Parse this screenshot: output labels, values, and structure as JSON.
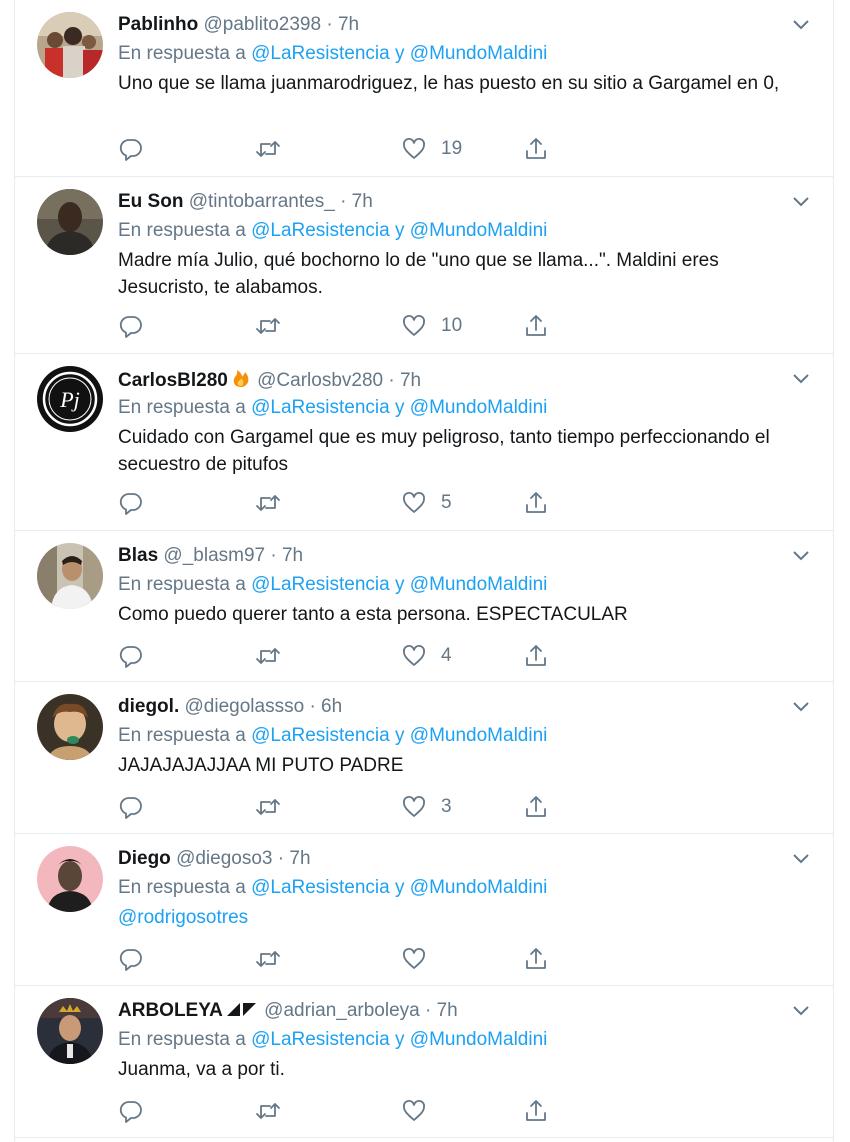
{
  "tweets": [
    {
      "name": "Pablinho",
      "handle": "@pablito2398",
      "time": "7h",
      "reply_prefix": "En respuesta a",
      "reply_to_1": "@LaResistencia",
      "reply_and": "y",
      "reply_to_2": "@MundoMaldini",
      "text": "Uno que se llama juanmarodriguez, le has puesto en su sitio a Gargamel en 0,",
      "likes": "19",
      "avatar": "avatar-group-red-shirts"
    },
    {
      "name": "Eu Son",
      "handle": "@tintobarrantes_",
      "time": "7h",
      "reply_prefix": "En respuesta a",
      "reply_to_1": "@LaResistencia",
      "reply_and": "y",
      "reply_to_2": "@MundoMaldini",
      "text": "Madre mía Julio, qué bochorno lo de \"uno que se llama...\". Maldini eres Jesucristo, te alabamos.",
      "likes": "10",
      "avatar": "avatar-man-dark"
    },
    {
      "name": "CarlosBl280",
      "name_badge": "fire-emoji",
      "handle": "@Carlosbv280",
      "time": "7h",
      "reply_prefix": "En respuesta a",
      "reply_to_1": "@LaResistencia",
      "reply_and": "y",
      "reply_to_2": "@MundoMaldini",
      "text": "Cuidado con Gargamel que es muy peligroso, tanto tiempo perfeccionando el secuestro de pitufos",
      "likes": "5",
      "avatar": "avatar-pj-logo",
      "avatar_logo_text": "Pj"
    },
    {
      "name": "Blas",
      "handle": "@_blasm97",
      "time": "7h",
      "reply_prefix": "En respuesta a",
      "reply_to_1": "@LaResistencia",
      "reply_and": "y",
      "reply_to_2": "@MundoMaldini",
      "text": "Como puedo querer tanto a esta persona. ESPECTACULAR",
      "likes": "4",
      "avatar": "avatar-man-street"
    },
    {
      "name": "diegol.",
      "handle": "@diegolassso",
      "time": "6h",
      "reply_prefix": "En respuesta a",
      "reply_to_1": "@LaResistencia",
      "reply_and": "y",
      "reply_to_2": "@MundoMaldini",
      "text": "JAJAJAJAJJAA MI PUTO PADRE",
      "likes": "3",
      "avatar": "avatar-child"
    },
    {
      "name": "Diego",
      "handle": "@diegoso3",
      "time": "7h",
      "reply_prefix": "En respuesta a",
      "reply_to_1": "@LaResistencia",
      "reply_and": "y",
      "reply_to_2": "@MundoMaldini",
      "text": "@rodrigosotres",
      "text_is_link": true,
      "likes": "",
      "avatar": "avatar-man-pink-bg"
    },
    {
      "name": "ARBOLEYA",
      "name_badge": "black-triangles",
      "handle": "@adrian_arboleya",
      "time": "7h",
      "reply_prefix": "En respuesta a",
      "reply_to_1": "@LaResistencia",
      "reply_and": "y",
      "reply_to_2": "@MundoMaldini",
      "text": "Juanma, va a por ti.",
      "likes": "",
      "avatar": "avatar-man-crown"
    }
  ],
  "icons": {
    "reply": "reply-icon",
    "retweet": "retweet-icon",
    "like": "heart-icon",
    "share": "share-icon",
    "menu": "chevron-down-icon"
  },
  "colors": {
    "link": "#1da1f2",
    "muted": "#657786",
    "text": "#14171a",
    "divider": "#e6ecf0"
  }
}
